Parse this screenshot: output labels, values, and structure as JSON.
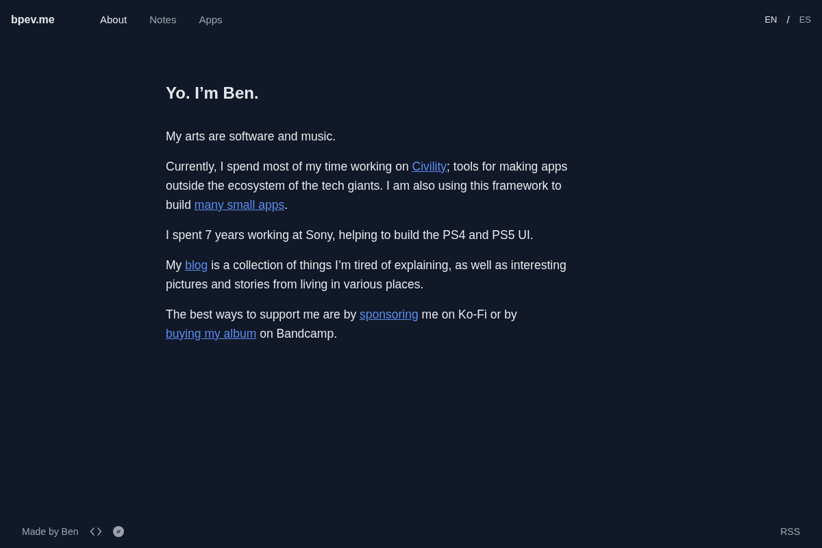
{
  "header": {
    "brand": "bpev.me",
    "nav": [
      {
        "label": "About",
        "selected": true
      },
      {
        "label": "Notes",
        "selected": false
      },
      {
        "label": "Apps",
        "selected": false
      }
    ],
    "languages": [
      {
        "label": "EN",
        "selected": true
      },
      {
        "label": "ES",
        "selected": false
      }
    ],
    "language_separator": "/"
  },
  "main": {
    "title": "Yo. I’m Ben.",
    "paragraphs": [
      [
        {
          "kind": "text",
          "text": "My arts are software and music."
        }
      ],
      [
        {
          "kind": "text",
          "text": "Currently, I spend most of my time working on "
        },
        {
          "kind": "link",
          "text": "Civility"
        },
        {
          "kind": "text",
          "text": "; tools for making apps outside the ecosystem of the tech giants. I am also using this framework to build "
        },
        {
          "kind": "link",
          "text": "many small apps"
        },
        {
          "kind": "text",
          "text": "."
        }
      ],
      [
        {
          "kind": "text",
          "text": "I spent 7 years working at Sony, helping to build the PS4 and PS5 UI."
        }
      ],
      [
        {
          "kind": "text",
          "text": "My "
        },
        {
          "kind": "link",
          "text": "blog"
        },
        {
          "kind": "text",
          "text": " is a collection of things I’m tired of explaining, as well as interesting pictures and stories from living in various places."
        }
      ],
      [
        {
          "kind": "text",
          "text": "The best ways to support me are by "
        },
        {
          "kind": "link",
          "text": "sponsoring"
        },
        {
          "kind": "text",
          "text": " me on Ko-Fi or by "
        },
        {
          "kind": "link",
          "text": "buying my album"
        },
        {
          "kind": "text",
          "text": " on Bandcamp."
        }
      ]
    ]
  },
  "footer": {
    "credit": "Made by Ben",
    "rss": "RSS"
  }
}
